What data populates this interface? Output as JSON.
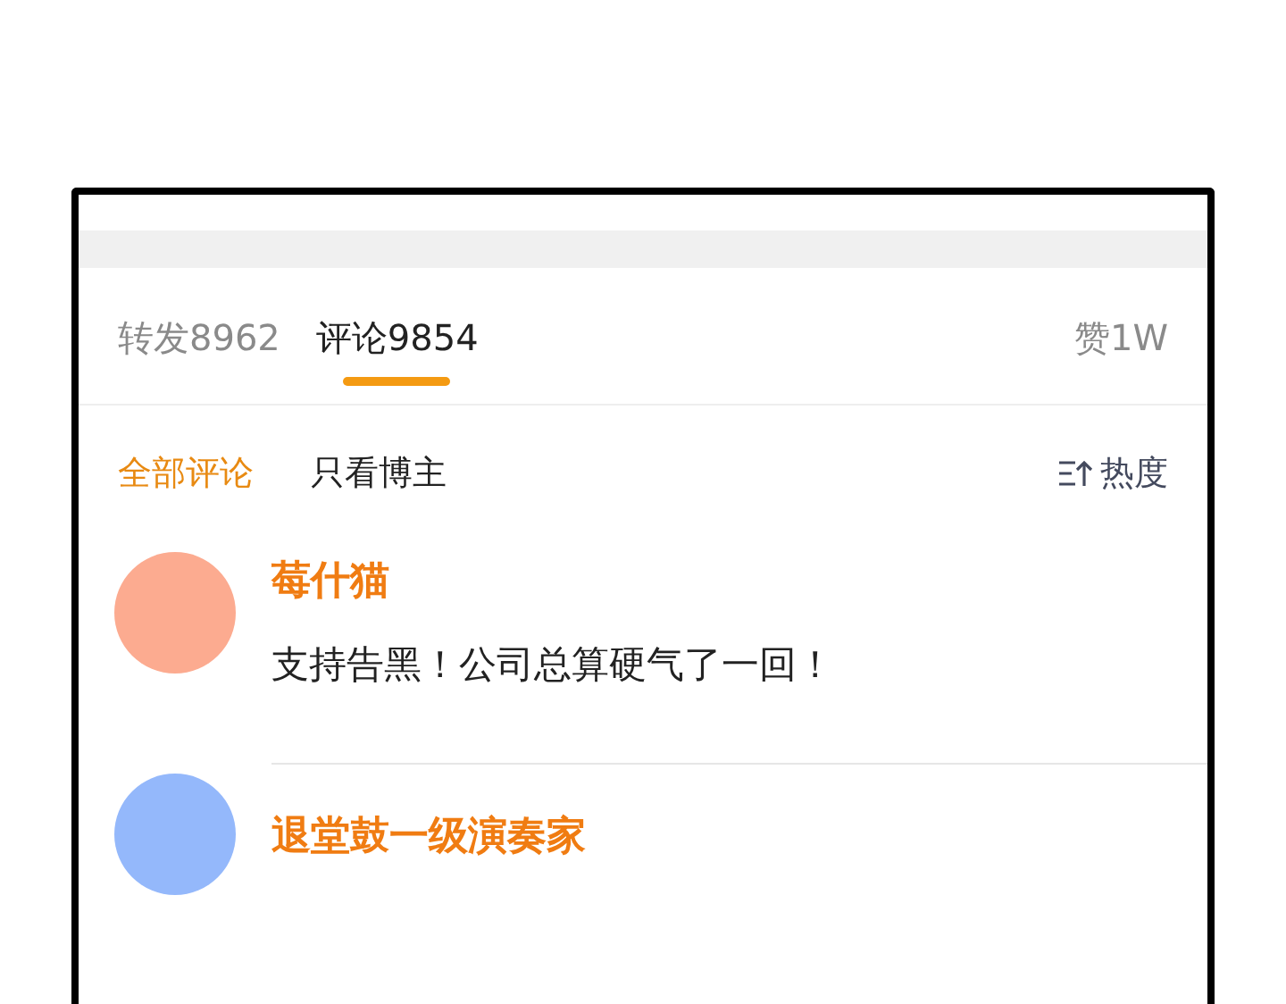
{
  "tabs": [
    {
      "label": "转发",
      "count": "8962",
      "selected": false
    },
    {
      "label": "评论",
      "count": "9854",
      "selected": true
    }
  ],
  "likes": {
    "label": "赞",
    "count": "1W"
  },
  "filters": [
    {
      "label": "全部评论",
      "selected": true
    },
    {
      "label": "只看博主",
      "selected": false
    }
  ],
  "sort": {
    "label": "热度"
  },
  "comments": [
    {
      "name": "莓什猫",
      "color": "#fcab90",
      "text": "支持告黑！公司总算硬气了一回！"
    },
    {
      "name": "退堂鼓一级演奏家",
      "color": "#94b8fb"
    }
  ]
}
